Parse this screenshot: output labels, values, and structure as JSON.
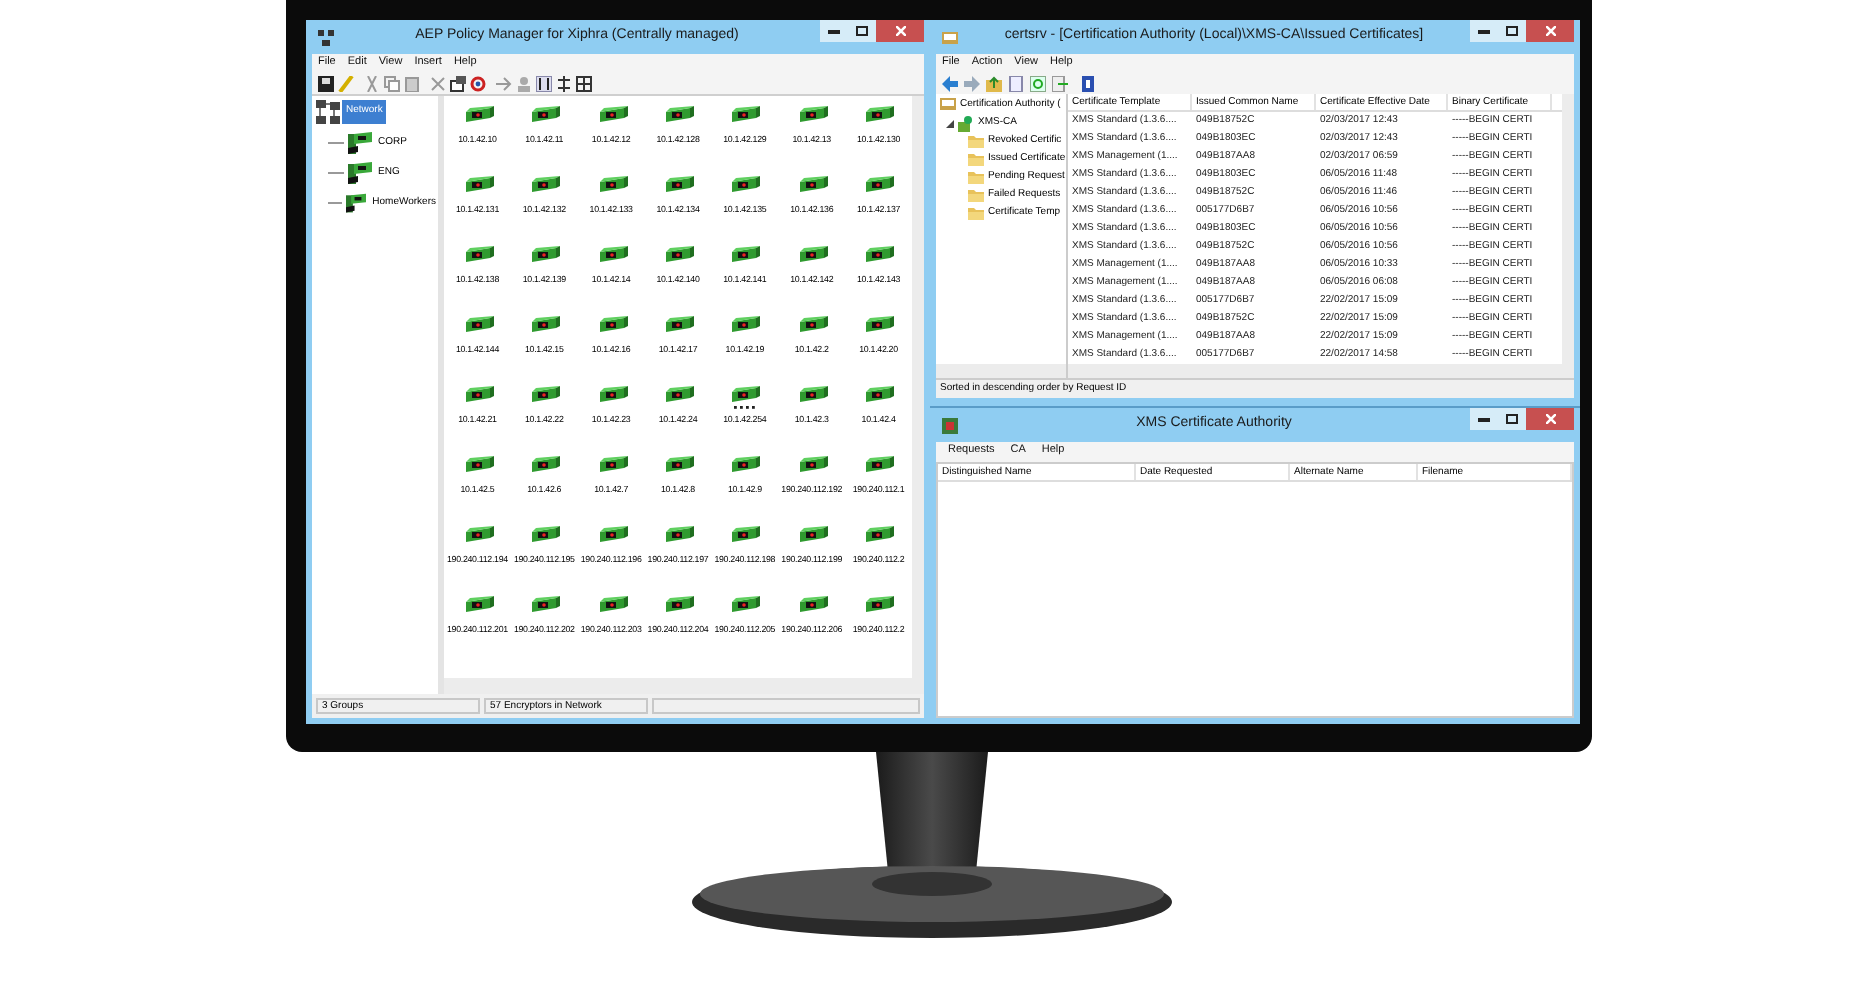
{
  "left_window": {
    "title": "AEP Policy Manager for Xiphra  (Centrally managed)",
    "menu": [
      "File",
      "Edit",
      "View",
      "Insert",
      "Help"
    ],
    "tree": {
      "label": "Network",
      "selected": true,
      "children": [
        {
          "label": "CORP",
          "selected": false
        },
        {
          "label": "ENG",
          "selected": false
        },
        {
          "label": "HomeWorkers",
          "selected": false
        }
      ]
    },
    "encryptors": [
      {
        "label": "10.1.42.10",
        "kind": "plain"
      },
      {
        "label": "10.1.42.11",
        "kind": "plain"
      },
      {
        "label": "10.1.42.12",
        "kind": "plain"
      },
      {
        "label": "10.1.42.128",
        "kind": "plain"
      },
      {
        "label": "10.1.42.129",
        "kind": "plain"
      },
      {
        "label": "10.1.42.13",
        "kind": "plain"
      },
      {
        "label": "10.1.42.130",
        "kind": "plain"
      },
      {
        "label": "10.1.42.131",
        "kind": "plain"
      },
      {
        "label": "10.1.42.132",
        "kind": "plain"
      },
      {
        "label": "10.1.42.133",
        "kind": "plain"
      },
      {
        "label": "10.1.42.134",
        "kind": "plain"
      },
      {
        "label": "10.1.42.135",
        "kind": "plain"
      },
      {
        "label": "10.1.42.136",
        "kind": "plain"
      },
      {
        "label": "10.1.42.137",
        "kind": "plain"
      },
      {
        "label": "10.1.42.138",
        "kind": "plain"
      },
      {
        "label": "10.1.42.139",
        "kind": "plain"
      },
      {
        "label": "10.1.42.14",
        "kind": "plain"
      },
      {
        "label": "10.1.42.140",
        "kind": "plain"
      },
      {
        "label": "10.1.42.141",
        "kind": "plain"
      },
      {
        "label": "10.1.42.142",
        "kind": "plain"
      },
      {
        "label": "10.1.42.143",
        "kind": "plain"
      },
      {
        "label": "10.1.42.144",
        "kind": "plain"
      },
      {
        "label": "10.1.42.15",
        "kind": "plain"
      },
      {
        "label": "10.1.42.16",
        "kind": "plain"
      },
      {
        "label": "10.1.42.17",
        "kind": "plain"
      },
      {
        "label": "10.1.42.19",
        "kind": "plain"
      },
      {
        "label": "10.1.42.2",
        "kind": "plain"
      },
      {
        "label": "10.1.42.20",
        "kind": "plain"
      },
      {
        "label": "10.1.42.21",
        "kind": "plain"
      },
      {
        "label": "10.1.42.22",
        "kind": "plain"
      },
      {
        "label": "10.1.42.23",
        "kind": "plain"
      },
      {
        "label": "10.1.42.24",
        "kind": "plain"
      },
      {
        "label": "10.1.42.254",
        "kind": "dotted"
      },
      {
        "label": "10.1.42.3",
        "kind": "plain"
      },
      {
        "label": "10.1.42.4",
        "kind": "plain"
      },
      {
        "label": "10.1.42.5",
        "kind": "plain"
      },
      {
        "label": "10.1.42.6",
        "kind": "plain"
      },
      {
        "label": "10.1.42.7",
        "kind": "plain"
      },
      {
        "label": "10.1.42.8",
        "kind": "plain"
      },
      {
        "label": "10.1.42.9",
        "kind": "plain"
      },
      {
        "label": "190.240.112.192",
        "kind": "plain"
      },
      {
        "label": "190.240.112.1",
        "kind": "plain"
      },
      {
        "label": "190.240.112.194",
        "kind": "plain"
      },
      {
        "label": "190.240.112.195",
        "kind": "plain"
      },
      {
        "label": "190.240.112.196",
        "kind": "plain"
      },
      {
        "label": "190.240.112.197",
        "kind": "plain"
      },
      {
        "label": "190.240.112.198",
        "kind": "plain"
      },
      {
        "label": "190.240.112.199",
        "kind": "plain"
      },
      {
        "label": "190.240.112.2",
        "kind": "plain"
      },
      {
        "label": "190.240.112.201",
        "kind": "plain"
      },
      {
        "label": "190.240.112.202",
        "kind": "plain"
      },
      {
        "label": "190.240.112.203",
        "kind": "plain"
      },
      {
        "label": "190.240.112.204",
        "kind": "plain"
      },
      {
        "label": "190.240.112.205",
        "kind": "plain"
      },
      {
        "label": "190.240.112.206",
        "kind": "plain"
      },
      {
        "label": "190.240.112.2",
        "kind": "plain"
      }
    ],
    "status_bar": [
      "3 Groups",
      "57 Encryptors in Network"
    ]
  },
  "certsrv_window": {
    "title": "certsrv - [Certification Authority (Local)\\XMS-CA\\Issued Certificates]",
    "menu": [
      "File",
      "Action",
      "View",
      "Help"
    ],
    "tree": {
      "label": "Certification Authority (",
      "children": [
        {
          "label": "XMS-CA",
          "expanded": true,
          "children": [
            {
              "label": "Revoked Certific"
            },
            {
              "label": "Issued Certificate"
            },
            {
              "label": "Pending Request"
            },
            {
              "label": "Failed Requests"
            },
            {
              "label": "Certificate Temp"
            }
          ]
        }
      ]
    },
    "table": {
      "columns": [
        "Certificate Template",
        "Issued Common Name",
        "Certificate Effective Date",
        "Binary Certificate"
      ],
      "rows": [
        [
          "XMS Standard (1.3.6....",
          "049B18752C",
          "02/03/2017 12:43",
          "-----BEGIN CERTI"
        ],
        [
          "XMS Standard (1.3.6....",
          "049B1803EC",
          "02/03/2017 12:43",
          "-----BEGIN CERTI"
        ],
        [
          "XMS Management (1....",
          "049B187AA8",
          "02/03/2017 06:59",
          "-----BEGIN CERTI"
        ],
        [
          "XMS Standard (1.3.6....",
          "049B1803EC",
          "06/05/2016 11:48",
          "-----BEGIN CERTI"
        ],
        [
          "XMS Standard (1.3.6....",
          "049B18752C",
          "06/05/2016 11:46",
          "-----BEGIN CERTI"
        ],
        [
          "XMS Standard (1.3.6....",
          "005177D6B7",
          "06/05/2016 10:56",
          "-----BEGIN CERTI"
        ],
        [
          "XMS Standard (1.3.6....",
          "049B1803EC",
          "06/05/2016 10:56",
          "-----BEGIN CERTI"
        ],
        [
          "XMS Standard (1.3.6....",
          "049B18752C",
          "06/05/2016 10:56",
          "-----BEGIN CERTI"
        ],
        [
          "XMS Management (1....",
          "049B187AA8",
          "06/05/2016 10:33",
          "-----BEGIN CERTI"
        ],
        [
          "XMS Management (1....",
          "049B187AA8",
          "06/05/2016 06:08",
          "-----BEGIN CERTI"
        ],
        [
          "XMS Standard (1.3.6....",
          "005177D6B7",
          "22/02/2017 15:09",
          "-----BEGIN CERTI"
        ],
        [
          "XMS Standard (1.3.6....",
          "049B18752C",
          "22/02/2017 15:09",
          "-----BEGIN CERTI"
        ],
        [
          "XMS Management (1....",
          "049B187AA8",
          "22/02/2017 15:09",
          "-----BEGIN CERTI"
        ],
        [
          "XMS Standard (1.3.6....",
          "005177D6B7",
          "22/02/2017 14:58",
          "-----BEGIN CERTI"
        ]
      ]
    },
    "status_bar": "Sorted in descending order by Request ID"
  },
  "xms_window": {
    "title": "XMS Certificate Authority",
    "menu": [
      "Requests",
      "CA",
      "Help"
    ],
    "columns": [
      "Distinguished Name",
      "Date Requested",
      "Alternate Name",
      "Filename"
    ]
  }
}
